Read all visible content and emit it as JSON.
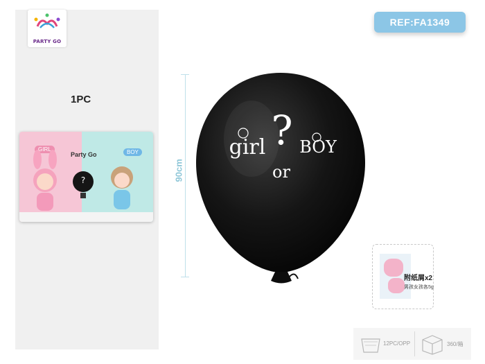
{
  "brand": {
    "logo_text": "PARTY GO"
  },
  "product": {
    "quantity_label": "1PC",
    "reference": "REF:FA1349",
    "dimension_label": "90cm",
    "balloon_text": {
      "line1_left": "girl",
      "question_mark": "?",
      "line1_right": "BOY",
      "line2": "or"
    },
    "package": {
      "title": "Party Go",
      "girl_tag": "GIRL",
      "boy_tag": "BOY"
    }
  },
  "accessory": {
    "label": "附纸屑x2",
    "note": "男孩女孩各5g"
  },
  "specs": [
    {
      "icon": "bag-icon",
      "text": "12PC/OPP"
    },
    {
      "icon": "box-icon",
      "text": "360/箱"
    }
  ],
  "colors": {
    "ref_badge": "#8cc6e6",
    "dimension": "#8fc7d8",
    "balloon": "#111111",
    "package_pink": "#f6c6d6",
    "package_blue": "#bfe9e6"
  }
}
